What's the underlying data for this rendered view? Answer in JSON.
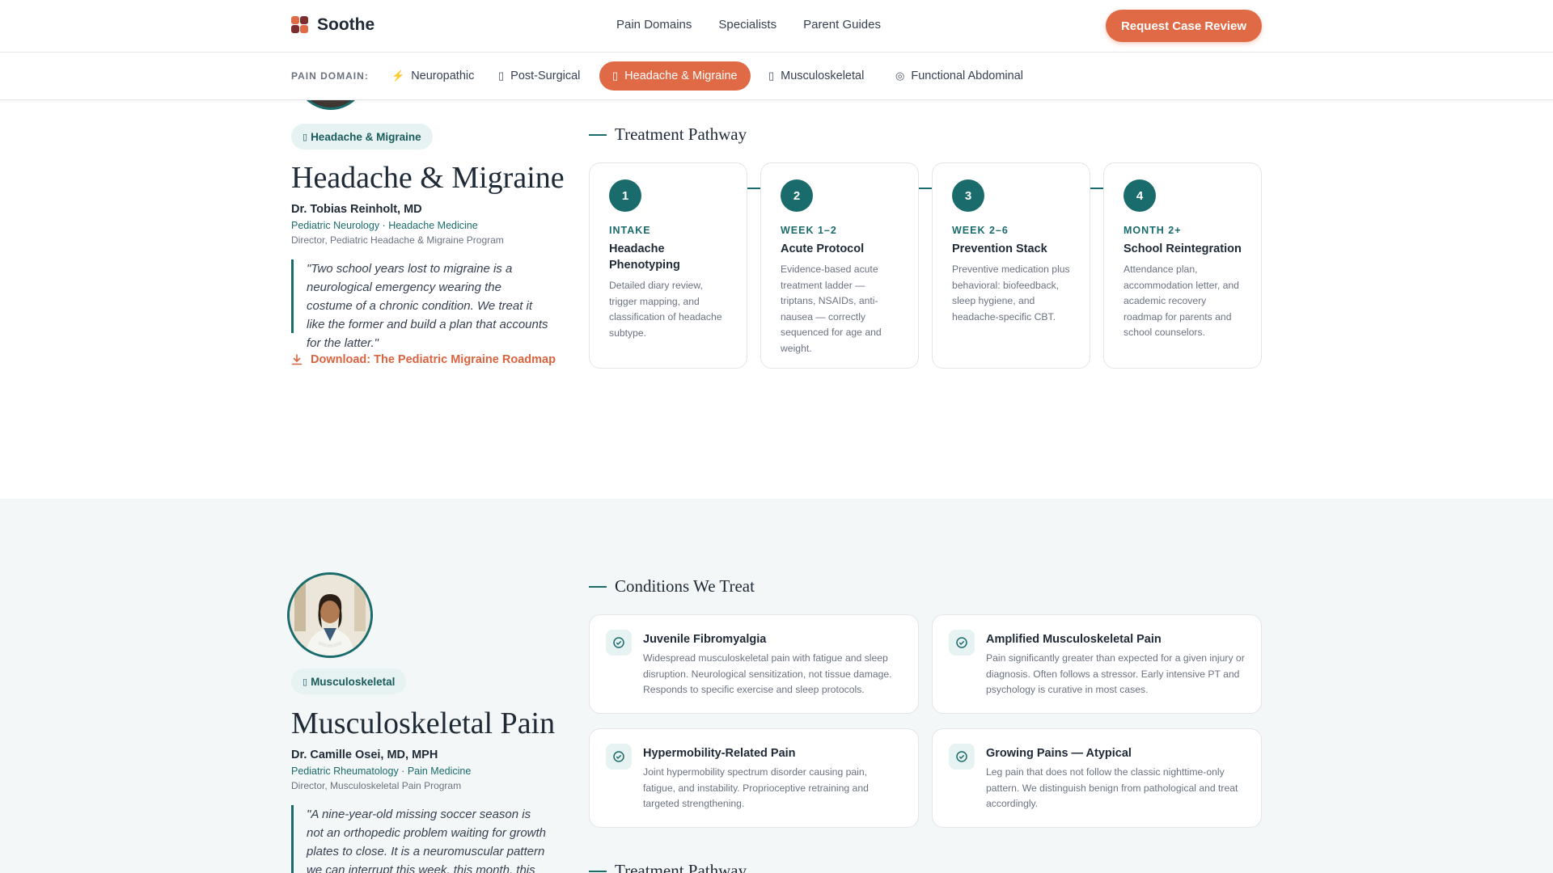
{
  "header": {
    "brand": "Soothe",
    "nav": [
      "Pain Domains",
      "Specialists",
      "Parent Guides"
    ],
    "cta_label": "Request Case Review"
  },
  "filter": {
    "label": "PAIN DOMAIN:",
    "chips": [
      {
        "icon": "⚡",
        "label": "Neuropathic"
      },
      {
        "icon": "▯",
        "label": "Post-Surgical"
      },
      {
        "icon": "▯",
        "label": "Headache & Migraine"
      },
      {
        "icon": "▯",
        "label": "Musculoskeletal"
      },
      {
        "icon": "◎",
        "label": "Functional Abdominal"
      }
    ],
    "active": "Headache & Migraine"
  },
  "headache": {
    "tag": "Headache & Migraine",
    "title": "Headache & Migraine",
    "doctor": "Dr. Tobias Reinholt, MD",
    "specialties": "Pediatric Neurology · Headache Medicine",
    "role": "Director, Pediatric Headache & Migraine Program",
    "quote": "\"Two school years lost to migraine is a neurological emergency wearing the costume of a chronic condition. We treat it like the former and build a plan that accounts for the latter.\"",
    "download": "Download: The Pediatric Migraine Roadmap",
    "pathway_heading": "Treatment Pathway",
    "steps": [
      {
        "num": "1",
        "week": "INTAKE",
        "title": "Headache Phenotyping",
        "desc": "Detailed diary review, trigger mapping, and classification of headache subtype."
      },
      {
        "num": "2",
        "week": "WEEK 1–2",
        "title": "Acute Protocol",
        "desc": "Evidence-based acute treatment ladder — triptans, NSAIDs, anti-nausea — correctly sequenced for age and weight."
      },
      {
        "num": "3",
        "week": "WEEK 2–6",
        "title": "Prevention Stack",
        "desc": "Preventive medication plus behavioral: biofeedback, sleep hygiene, and headache-specific CBT."
      },
      {
        "num": "4",
        "week": "MONTH 2+",
        "title": "School Reintegration",
        "desc": "Attendance plan, accommodation letter, and academic recovery roadmap for parents and school counselors."
      }
    ]
  },
  "msk": {
    "tag": "Musculoskeletal",
    "title": "Musculoskeletal Pain",
    "doctor": "Dr. Camille Osei, MD, MPH",
    "specialties": "Pediatric Rheumatology · Pain Medicine",
    "role": "Director, Musculoskeletal Pain Program",
    "quote": "\"A nine-year-old missing soccer season is not an orthopedic problem waiting for growth plates to close. It is a neuromuscular pattern we can interrupt this week, this month, this season.\"",
    "conditions_heading": "Conditions We Treat",
    "conditions": [
      {
        "title": "Juvenile Fibromyalgia",
        "desc": "Widespread musculoskeletal pain with fatigue and sleep disruption. Neurological sensitization, not tissue damage. Responds to specific exercise and sleep protocols."
      },
      {
        "title": "Amplified Musculoskeletal Pain",
        "desc": "Pain significantly greater than expected for a given injury or diagnosis. Often follows a stressor. Early intensive PT and psychology is curative in most cases."
      },
      {
        "title": "Hypermobility-Related Pain",
        "desc": "Joint hypermobility spectrum disorder causing pain, fatigue, and instability. Proprioceptive retraining and targeted strengthening."
      },
      {
        "title": "Growing Pains — Atypical",
        "desc": "Leg pain that does not follow the classic nighttime-only pattern. We distinguish benign from pathological and treat accordingly."
      }
    ],
    "pathway_heading": "Treatment Pathway"
  },
  "colors": {
    "accent": "#e06a45",
    "teal": "#1a6b6b"
  }
}
